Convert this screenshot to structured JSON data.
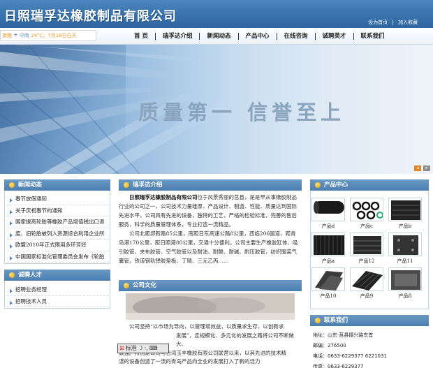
{
  "header": {
    "logo": "日照瑞孚达橡胶制品有限公司",
    "set_home": "设为首页",
    "separator": "|",
    "add_favorite": "加入收藏"
  },
  "weather": {
    "part1": "夜晚",
    "part2": "中雨",
    "part3": "24°C；7月18日白天"
  },
  "nav": [
    "首 页",
    "瑞孚达介绍",
    "新闻动态",
    "产品中心",
    "在线咨询",
    "诚聘英才",
    "联系我们"
  ],
  "banner": {
    "slogan": "质量第一  信誉至上"
  },
  "news": {
    "title": "新闻动态",
    "items": [
      "春节放假通知",
      "关于庆祝春节的通知",
      "国家提高轮胎等橡胶产品增值税出口退",
      "废、旧轮胎被列入资源综合利用企业所",
      "欧盟2010年正式限用多环芳烃",
      "中国国家标准化管理委员会发布《轮胎"
    ]
  },
  "jobs": {
    "title": "诚聘人才",
    "items": [
      "招聘业务经理",
      "招聘技术人员"
    ]
  },
  "intro": {
    "title": "瑞孚达介绍",
    "company": "日照瑞孚达橡胶制品有限公司",
    "p1": "位于风景秀丽的莒县，是是早从事橡胶制品行业的公司之一，公司技术力量雄厚，产品设计、制造、性能、质量达到国际先进水平，公司具有先进的设备，独特的工艺，严格的检验标准，完善的售后服务，科学的质量管理体系，专业打造一流精品。",
    "p2": "公司北距郯新路85公里，南距日东高速公路8公里，西临206国道，距青岛港170公里，距日照港80公里，交通十分便利。公司主要生产橡胶缸体、吸引胶管、夹布胶管、空气胶管以及耐油、耐酸、耐碱、耐压胶管，纺织服装气囊管，铁道钢轨弹胶垫板、丁晴、三元乙丙……"
  },
  "culture": {
    "title": "公司文化",
    "line1": "公司坚持“以市场为导向，以管理增效益，以质量求生存，以创新求",
    "line2": "发展”，走规模化、多元化的发展之路将公司不断做大、",
    "line3": "做强。特别是公司与台湾玉丰橡胶有限公司联营以来，以其先进的技术精",
    "line4": "湛的设备创造了一流的青岛产品向全业的发展打入了新的活力"
  },
  "products": {
    "title": "产品中心",
    "items": [
      "产品d",
      "产品c",
      "产品b",
      "产品a",
      "产品12",
      "产品11",
      "产品10",
      "产品9",
      "产品8"
    ]
  },
  "contact": {
    "title": "联系我们",
    "address": "地址：山东·莒县振兴路东首",
    "postcode": "邮编：276500",
    "phone": "电话：0633-6229377  6221031",
    "fax": "传真：0633-6229377"
  },
  "ime": {
    "label": "标准"
  },
  "colors": {
    "header_blue": "#3a74ad",
    "section_blue": "#4b7fb1",
    "accent_orange": "#e89b2a"
  }
}
